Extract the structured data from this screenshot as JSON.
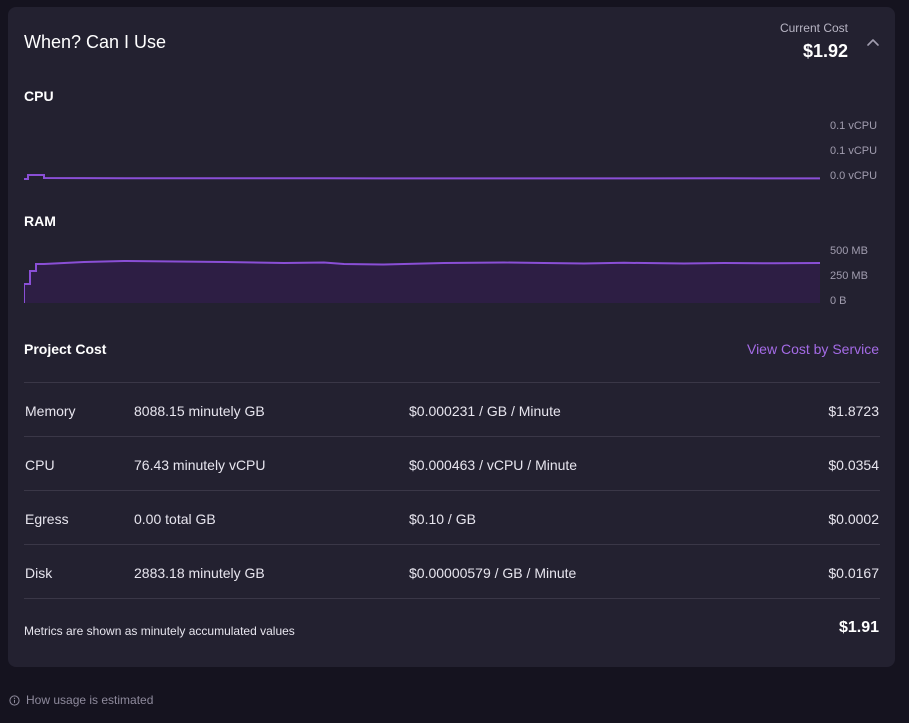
{
  "header": {
    "title": "When? Can I Use",
    "current_cost_label": "Current Cost",
    "current_cost_value": "$1.92"
  },
  "cpu_chart": {
    "label": "CPU",
    "tick_labels": [
      "0.1 vCPU",
      "0.1 vCPU",
      "0.0 vCPU"
    ],
    "line_color": "#8a4fd6"
  },
  "ram_chart": {
    "label": "RAM",
    "tick_labels": [
      "500 MB",
      "250 MB",
      "0 B"
    ],
    "line_color": "#8a4fd6",
    "fill_color": "#2d1e44"
  },
  "project_cost": {
    "title": "Project Cost",
    "link_label": "View Cost by Service",
    "rows": [
      {
        "name": "Memory",
        "usage": "8088.15 minutely GB",
        "rate": "$0.000231 / GB / Minute",
        "total": "$1.8723"
      },
      {
        "name": "CPU",
        "usage": "76.43 minutely vCPU",
        "rate": "$0.000463 / vCPU / Minute",
        "total": "$0.0354"
      },
      {
        "name": "Egress",
        "usage": "0.00 total GB",
        "rate": "$0.10 / GB",
        "total": "$0.0002"
      },
      {
        "name": "Disk",
        "usage": "2883.18 minutely GB",
        "rate": "$0.00000579 / GB / Minute",
        "total": "$0.0167"
      }
    ],
    "footnote": "Metrics are shown as minutely accumulated values",
    "grand_total": "$1.91"
  },
  "estimate_link": {
    "icon": "info-circle-icon",
    "label": "How usage is estimated"
  },
  "colors": {
    "background": "#15131f",
    "card": "#232130",
    "accent": "#a46be6",
    "divider": "#3a3747"
  }
}
